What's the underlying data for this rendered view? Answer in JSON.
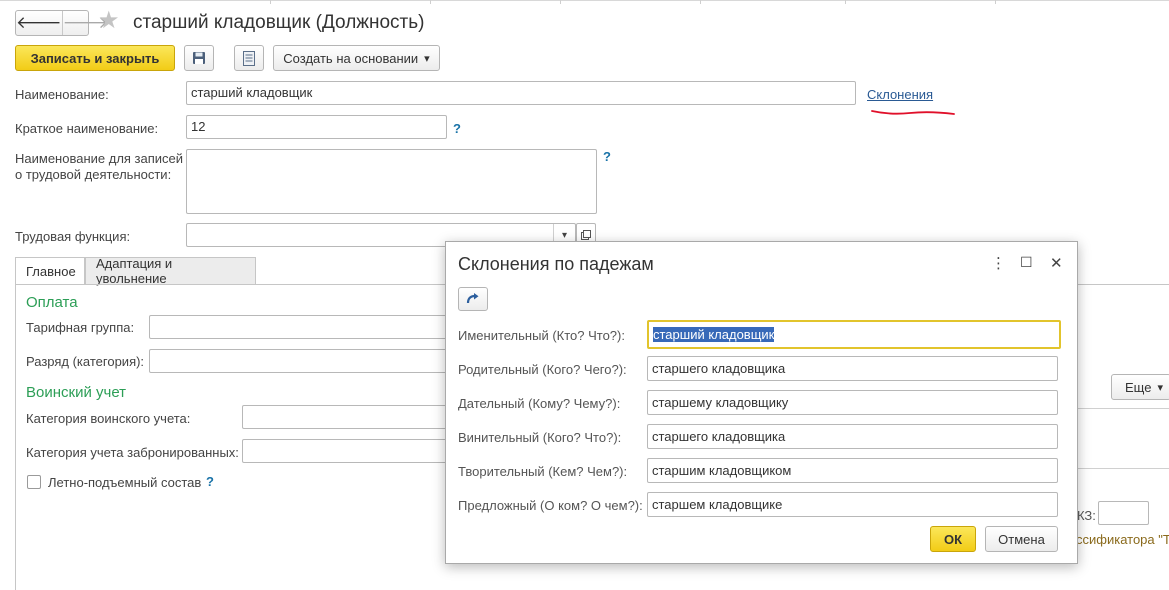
{
  "window": {
    "title": "старший кладовщик (Должность)",
    "back_glyph": "🡐",
    "forward_glyph": "🡒",
    "star_glyph": "★"
  },
  "toolbar": {
    "save_close_label": "Записать и закрыть",
    "save_icon": "floppy-disk-icon",
    "list_icon": "report-list-icon",
    "create_based_label": "Создать на основании",
    "dropdown_glyph": "▾"
  },
  "form": {
    "name_label": "Наименование:",
    "name_value": "старший кладовщик",
    "declensions_link": "Склонения",
    "short_name_label": "Краткое наименование:",
    "short_name_value": "12",
    "help_glyph": "?",
    "work_record_label_line1": "Наименование для записей",
    "work_record_label_line2": "о трудовой деятельности:",
    "work_record_value": "",
    "labor_function_label": "Трудовая функция:",
    "labor_function_value": ""
  },
  "tabs": [
    {
      "label": "Главное",
      "active": true
    },
    {
      "label": "Адаптация и увольнение",
      "active": false
    }
  ],
  "main": {
    "payment_heading": "Оплата",
    "tariff_group_label": "Тарифная группа:",
    "grade_label": "Разряд (категория):",
    "military_heading": "Воинский учет",
    "military_category_label": "Категория воинского учета:",
    "reserved_category_label": "Категория учета забронированных:",
    "flight_crew_label": "Летно-подъемный состав",
    "more_label": "Еще",
    "okz_label_fragment": "КЗ:",
    "classifier_fragment": "ссификатора \"Т"
  },
  "dialog": {
    "title": "Склонения по падежам",
    "menu_glyph": "⋮",
    "maximize_glyph": "☐",
    "close_glyph": "✕",
    "refresh_icon": "curved-arrow-icon",
    "cases": [
      {
        "label": "Именительный (Кто? Что?):",
        "value": "старший кладовщик",
        "focused": true
      },
      {
        "label": "Родительный (Кого? Чего?):",
        "value": "старшего кладовщика",
        "focused": false
      },
      {
        "label": "Дательный (Кому? Чему?):",
        "value": "старшему кладовщику",
        "focused": false
      },
      {
        "label": "Винительный (Кого? Что?):",
        "value": "старшего кладовщика",
        "focused": false
      },
      {
        "label": "Творительный (Кем? Чем?):",
        "value": "старшим кладовщиком",
        "focused": false
      },
      {
        "label": "Предложный (О ком? О чем?):",
        "value": "старшем кладовщике",
        "focused": false
      }
    ],
    "ok_label": "ОК",
    "cancel_label": "Отмена"
  },
  "colors": {
    "accent_yellow": "#f2cc16",
    "link_blue": "#2a5a94",
    "section_green": "#2c9e56",
    "annotation_red": "#e0102a"
  }
}
